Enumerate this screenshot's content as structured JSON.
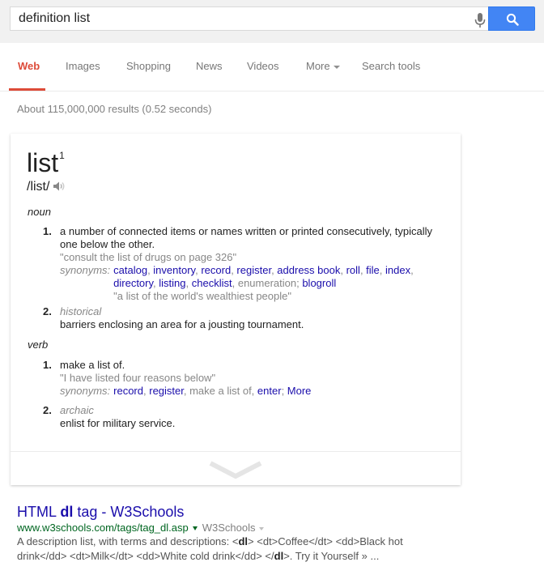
{
  "search": {
    "query": "definition list",
    "mic_icon": "microphone-icon",
    "search_icon": "magnifier-icon",
    "button_color": "#4285f4"
  },
  "tabs": [
    {
      "label": "Web",
      "active": true
    },
    {
      "label": "Images"
    },
    {
      "label": "Shopping"
    },
    {
      "label": "News"
    },
    {
      "label": "Videos"
    },
    {
      "label": "More"
    },
    {
      "label": "Search tools"
    }
  ],
  "accent_color": "#dd4b39",
  "stats": "About 115,000,000 results (0.52 seconds)",
  "definition": {
    "word": "list",
    "superscript": "1",
    "phonetic": "/list/",
    "noun": {
      "label": "noun",
      "senses": [
        {
          "num": "1.",
          "text": "a number of connected items or names written or printed consecutively, typically one below the other.",
          "example": "\"consult the list of drugs on page 326\"",
          "synonyms_label": "synonyms:",
          "synonyms": [
            {
              "t": "catalog",
              "link": true
            },
            {
              "t": ", "
            },
            {
              "t": "inventory",
              "link": true
            },
            {
              "t": ", "
            },
            {
              "t": "record",
              "link": true
            },
            {
              "t": ", "
            },
            {
              "t": "register",
              "link": true
            },
            {
              "t": ", "
            },
            {
              "t": "address book",
              "link": true
            },
            {
              "t": ", "
            },
            {
              "t": "roll",
              "link": true
            },
            {
              "t": ", "
            },
            {
              "t": "file",
              "link": true
            },
            {
              "t": ", "
            },
            {
              "t": "index",
              "link": true
            },
            {
              "t": ", "
            },
            {
              "t": "directory",
              "link": true
            },
            {
              "t": ", "
            },
            {
              "t": "listing",
              "link": true
            },
            {
              "t": ", "
            },
            {
              "t": "checklist",
              "link": true
            },
            {
              "t": ", enumeration; "
            },
            {
              "t": "blogroll",
              "link": true
            }
          ],
          "synonym_example": "\"a list of the world's wealthiest people\""
        },
        {
          "num": "2.",
          "label": "historical",
          "text": "barriers enclosing an area for a jousting tournament."
        }
      ]
    },
    "verb": {
      "label": "verb",
      "senses": [
        {
          "num": "1.",
          "text": "make a list of.",
          "example": "\"I have listed four reasons below\"",
          "synonyms_label": "synonyms:",
          "synonyms": [
            {
              "t": "record",
              "link": true
            },
            {
              "t": ", "
            },
            {
              "t": "register",
              "link": true
            },
            {
              "t": ", make a list of, "
            },
            {
              "t": "enter",
              "link": true
            },
            {
              "t": ";  "
            },
            {
              "t": "More",
              "link": true
            }
          ]
        },
        {
          "num": "2.",
          "label": "archaic",
          "text": "enlist for military service."
        }
      ]
    },
    "expand_icon": "chevron-down-icon"
  },
  "result": {
    "title_pre": "HTML ",
    "title_bold": "dl",
    "title_post": " tag - W3Schools",
    "url": "www.w3schools.com/tags/tag_dl.asp",
    "site": "W3Schools",
    "snippet_html_parts": [
      {
        "t": "A description list, with terms and descriptions: <"
      },
      {
        "t": "dl",
        "b": true
      },
      {
        "t": "> <dt>Coffee</dt> <dd>Black hot drink</dd> <dt>Milk</dt> <dd>White cold drink</dd> </"
      },
      {
        "t": "dl",
        "b": true
      },
      {
        "t": ">. Try it Yourself » ..."
      }
    ]
  }
}
